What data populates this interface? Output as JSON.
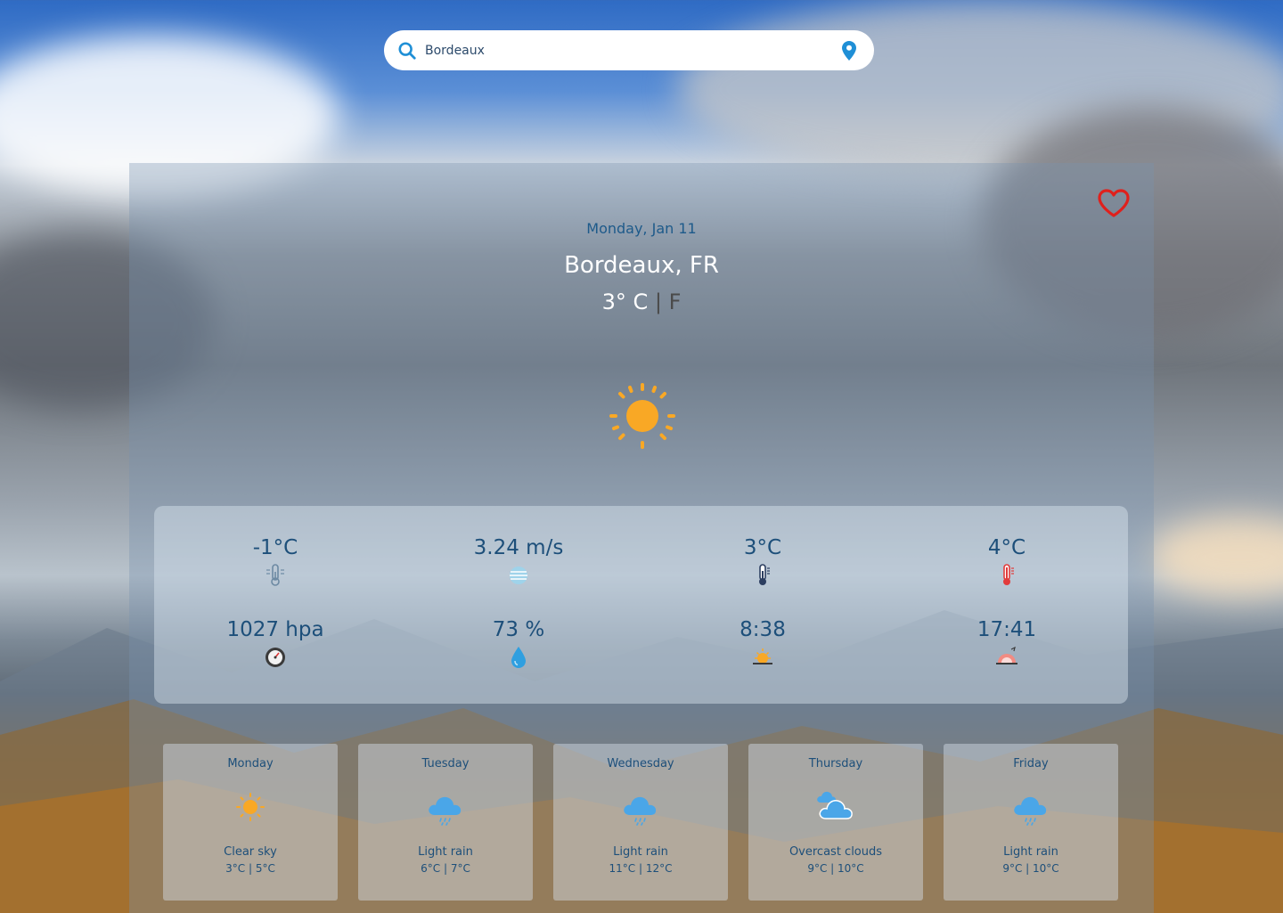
{
  "search": {
    "value": "Bordeaux",
    "placeholder": ""
  },
  "current": {
    "date": "Monday, Jan 11",
    "city": "Bordeaux, FR",
    "temp_value": "3°",
    "unit_c": "C",
    "separator": "|",
    "unit_f": "F",
    "icon": "sun-icon"
  },
  "stats": [
    {
      "value": "-1°C",
      "icon": "thermometer-min-icon"
    },
    {
      "value": "3.24 m/s",
      "icon": "wind-icon"
    },
    {
      "value": "3°C",
      "icon": "thermometer-icon"
    },
    {
      "value": "4°C",
      "icon": "thermometer-max-icon"
    },
    {
      "value": "1027 hpa",
      "icon": "barometer-icon"
    },
    {
      "value": "73 %",
      "icon": "humidity-drop-icon"
    },
    {
      "value": "8:38",
      "icon": "sunrise-icon"
    },
    {
      "value": "17:41",
      "icon": "sunset-icon"
    }
  ],
  "forecast": [
    {
      "day": "Monday",
      "desc": "Clear sky",
      "range": "3°C | 5°C",
      "icon": "sun-icon"
    },
    {
      "day": "Tuesday",
      "desc": "Light rain",
      "range": "6°C | 7°C",
      "icon": "rain-cloud-icon"
    },
    {
      "day": "Wednesday",
      "desc": "Light rain",
      "range": "11°C | 12°C",
      "icon": "rain-cloud-icon"
    },
    {
      "day": "Thursday",
      "desc": "Overcast clouds",
      "range": "9°C | 10°C",
      "icon": "overcast-clouds-icon"
    },
    {
      "day": "Friday",
      "desc": "Light rain",
      "range": "9°C | 10°C",
      "icon": "rain-cloud-icon"
    }
  ],
  "colors": {
    "accent": "#1f8fd6",
    "heart": "#e0201c",
    "text_blue": "#1d4f7a",
    "sun": "#f9a825"
  }
}
